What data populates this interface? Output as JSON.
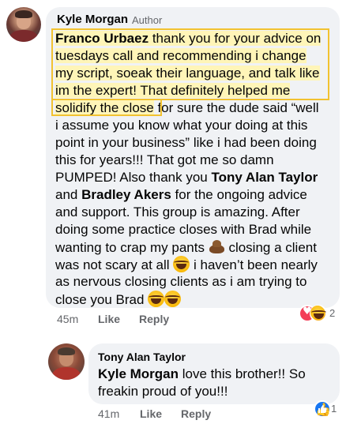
{
  "comment": {
    "author": "Kyle Morgan",
    "badge": "Author",
    "lines": [
      {
        "parts": [
          {
            "t": "Franco Urbaez",
            "b": true,
            "hl": true
          },
          {
            "t": " thank you for your advice on",
            "hl": true
          }
        ]
      },
      {
        "parts": [
          {
            "t": "tuesdays call and recommending i change",
            "hl": true
          }
        ]
      },
      {
        "parts": [
          {
            "t": "my script, soeak their language, and talk like",
            "hl": true
          }
        ]
      },
      {
        "parts": [
          {
            "t": "im the expert! That definitely helped me",
            "hl": true
          }
        ]
      },
      {
        "parts": [
          {
            "t": "solidify the close",
            "hl": true
          },
          {
            "t": " for sure the dude said “well"
          }
        ]
      },
      {
        "parts": [
          {
            "t": "i assume you know what your doing at this"
          }
        ]
      },
      {
        "parts": [
          {
            "t": "point in your business” like i had been doing"
          }
        ]
      },
      {
        "parts": [
          {
            "t": "this for years!!! That got me so damn"
          }
        ]
      },
      {
        "parts": [
          {
            "t": "PUMPED! Also thank you "
          },
          {
            "t": "Tony Alan Taylor",
            "b": true
          }
        ]
      },
      {
        "parts": [
          {
            "t": "and "
          },
          {
            "t": "Bradley Akers",
            "b": true
          },
          {
            "t": " for the ongoing advice"
          }
        ]
      },
      {
        "parts": [
          {
            "t": "and support. This group is amazing. After"
          }
        ]
      },
      {
        "parts": [
          {
            "t": "doing some practice closes with Brad while"
          }
        ]
      },
      {
        "parts": [
          {
            "t": "wanting to crap my pants "
          },
          {
            "emoji": "poop"
          },
          {
            "t": " closing a client"
          }
        ]
      },
      {
        "parts": [
          {
            "t": "was not scary at all "
          },
          {
            "emoji": "laugh"
          },
          {
            "t": " i haven’t been nearly"
          }
        ]
      },
      {
        "parts": [
          {
            "t": "as nervous closing clients as i am trying to"
          }
        ]
      },
      {
        "parts": [
          {
            "t": "close you Brad "
          },
          {
            "emoji": "laugh"
          },
          {
            "emoji": "laugh"
          }
        ]
      }
    ],
    "time": "45m",
    "like_label": "Like",
    "reply_label": "Reply",
    "reaction_count": "2"
  },
  "reply": {
    "author": "Tony Alan Taylor",
    "mention": "Kyle Morgan",
    "line1_rest": " love this brother!! So",
    "line2": "freakin proud of you!!!",
    "time": "41m",
    "like_label": "Like",
    "reply_label": "Reply",
    "reaction_count": "1"
  },
  "colors": {
    "bubble": "#f0f2f5",
    "highlight_border": "#f2c230",
    "highlight_fill": "#fff5b8",
    "meta_text": "#65676b",
    "heart": "#f33e58",
    "like": "#1877f2"
  }
}
